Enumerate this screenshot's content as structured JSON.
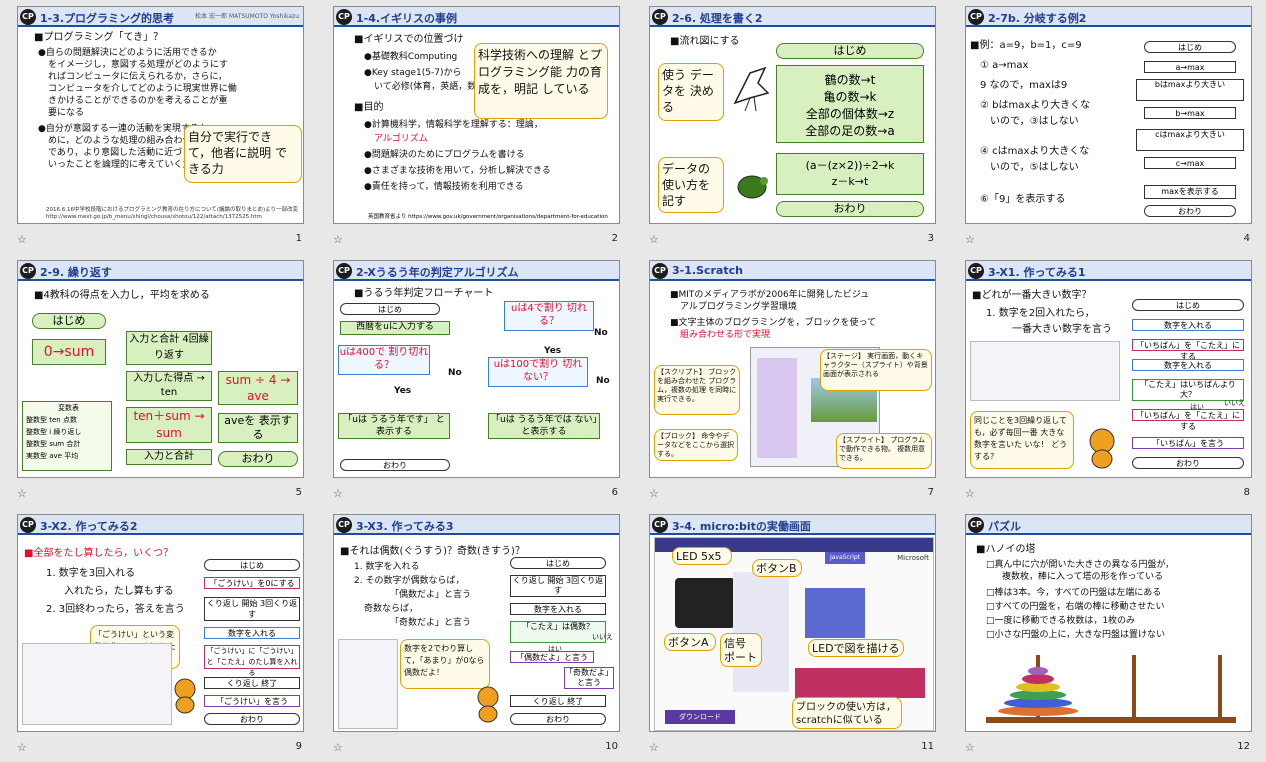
{
  "slides": [
    {
      "num": "1",
      "title": "1-3.プログラミング的思考",
      "lines": [
        "■プログラミング「てき」？",
        "●自らの問題解決にどのように活用できるか",
        "をイメージし，意図する処理がどのようにす",
        "ればコンピュータに伝えられるか，さらに，",
        "コンピュータを介してどのように現実世界に働",
        "きかけることができるのかを考えることが重",
        "要になる",
        "●自分が意図する一連の活動を実現するた",
        "めに，どのような処理の組み合わせが必要",
        "であり，より意図した活動に近づくのか，と",
        "いったことを論理的に考えていく力"
      ],
      "callout": "自分で実行でき て，他者に説明 できる力",
      "footer": "2016.6.16中学校段階におけるプログラミング教育の在り方について(議論の取りまとめ)より一部改変 http://www.mext.go.jp/b_menu/shingi/chousa/shotou/122/attach/1372525.htm"
    },
    {
      "num": "2",
      "title": "1-4.イギリスの事例",
      "lines": [
        "■イギリスでの位置づけ",
        "●基礎教科Computing",
        "●Key stage1(5-7)から",
        "いて必修(体育，英語，数学と同列)",
        "■目的",
        "●計算機科学，情報科学を理解する：理論，",
        "アルゴリズム",
        "●問題解決のためにプログラムを書ける",
        "●さまざまな技術を用いて，分析し解決できる",
        "●責任を持って，情報技術を利用できる"
      ],
      "callout": "科学技術への理解 とプログラミング能 力の育成を，明記 している",
      "footer": "英国教育省より https://www.gov.uk/government/organisations/department-for-education"
    },
    {
      "num": "3",
      "title": "2-6. 処理を書く2",
      "lines": [
        "■流れ図にする"
      ],
      "start": "はじめ",
      "p1": [
        "鶴の数→t",
        "亀の数→k",
        "全部の個体数→z",
        "全部の足の数→a"
      ],
      "p2": [
        "(a－(z×2))÷2→k",
        "z－k→t"
      ],
      "end": "おわり",
      "c1": "使う データを 決める",
      "c2": "データの 使い方を 記す"
    },
    {
      "num": "4",
      "title": "2-7b. 分岐する例2",
      "lines": [
        "■例：a=9，b=1，c=9",
        "① a→max",
        "9 なので，maxは9",
        "② bはmaxより大きくな",
        "いので，③はしない",
        "④ cはmaxより大きくな",
        "いので，⑤はしない",
        "⑥「9」を表示する"
      ],
      "flow": [
        "はじめ",
        "a→max",
        "bはmaxより大きい",
        "b→max",
        "cはmaxより大きい",
        "c→max",
        "maxを表示する",
        "おわり"
      ]
    },
    {
      "num": "5",
      "title": "2-9. 繰り返す",
      "lines": [
        "■4教科の得点を入力し，平均を求める"
      ],
      "flow": [
        "はじめ",
        "0→sum",
        "入力と合計 4回繰り返す",
        "入力した得点 → ten",
        "ten＋sum → sum",
        "入力と合計",
        "sum ÷ 4 → ave",
        "aveを 表示する",
        "おわり"
      ],
      "vars": [
        "変数表",
        "整数型 ten 点数",
        "整数型 i 繰り返し",
        "整数型 sum 合計",
        "実数型 ave 平均"
      ]
    },
    {
      "num": "6",
      "title": "2-Xうるう年の判定アルゴリズム",
      "lines": [
        "■うるう年判定フローチャート"
      ],
      "flow": [
        "はじめ",
        "西暦をuに入力する",
        "uは4で割り 切れる？",
        "uは400で 割り切れる？",
        "uは100で割り 切れない？",
        "「uは うるう年です」 と表示する",
        "「uは うるう年では ない」と表示する",
        "おわり",
        "No",
        "Yes",
        "No",
        "Yes",
        "No"
      ]
    },
    {
      "num": "7",
      "title": "3-1.Scratch",
      "lines": [
        "■MITのメディアラボが2006年に開発したビジュ",
        "アルプログラミング学習環境",
        "■文字主体のプログラミングを，ブロックを使って",
        "組み合わせる形で実現"
      ],
      "notes": [
        "【スクリプト】 ブロックを組み合わせた プログラム，複数の処理 を同時に実行できる。",
        "【ステージ】 実行画面，動くキャラクター（スプライト）や背景画面が表示される",
        "【ブロック】 命令やデータなどをここから選択する。",
        "【スプライト】 プログラムで動作できる物。 複数用意できる。"
      ]
    },
    {
      "num": "8",
      "title": "3-X1. 作ってみる1",
      "lines": [
        "■どれが一番大きい数字？",
        "1. 数字を2回入れたら，",
        "一番大きい数字を言う"
      ],
      "flow": [
        "はじめ",
        "数字を入れる",
        "「いちばん」を「こたえ」にする",
        "数字を入れる",
        "「こたえ」はいちばんより大？",
        "「いちばん」を「こたえ」にする",
        "「いちばん」を言う",
        "おわり",
        "いいえ",
        "はい"
      ],
      "callout": "同じことを3回繰り返して も，必ず毎回一番 大きな数字を言いた いな！ どうする？"
    },
    {
      "num": "9",
      "title": "3-X2. 作ってみる2",
      "lines": [
        "■全部をたし算したら，いくつ？",
        "1. 数字を3回入れる",
        "入れたら，たし算もする",
        "2. 3回終わったら，答えを言う"
      ],
      "flow": [
        "はじめ",
        "「ごうけい」を0にする",
        "くり返し 開始 3回くり返す",
        "数字を入れる",
        "「ごうけい」に「ごうけい」と「こたえ」のたし算を入れる",
        "くり返し 終了",
        "「ごうけい」を言う",
        "おわり"
      ],
      "callout": "「ごうけい」という変 数を作って，それ にたし算していく"
    },
    {
      "num": "10",
      "title": "3-X3. 作ってみる3",
      "lines": [
        "■それは偶数(ぐうすう)？奇数(きすう)？",
        "1. 数字を入れる",
        "2. その数字が偶数ならば，",
        "「偶数だよ」と言う",
        "奇数ならば，",
        "「奇数だよ」と言う"
      ],
      "flow": [
        "はじめ",
        "くり返し 開始 3回くり返す",
        "数字を入れる",
        "「こたえ」は偶数？",
        "「偶数だよ」と言う",
        "「奇数だよ」と言う",
        "くり返し 終了",
        "おわり",
        "はい",
        "いいえ"
      ],
      "callout": "数字を2でわり算して，「あまり」が0なら偶数だよ！"
    },
    {
      "num": "11",
      "title": "3-4. micro:bitの実働画面",
      "labels": [
        "LED 5x5",
        "ボタンB",
        "ボタンA",
        "信号 ポート",
        "LEDで図を描ける",
        "ブロックの使い方は， scratchに似ている"
      ],
      "download": "ダウンロード",
      "ms": "Microsoft",
      "js": "JavaScript"
    },
    {
      "num": "12",
      "title": "パズル",
      "lines": [
        "■ハノイの塔",
        "□真ん中に穴が開いた大きさの異なる円盤が，",
        "複数枚，棒に入って塔の形を作っている",
        "□棒は3本。今，すべての円盤は左端にある",
        "□すべての円盤を，右端の棒に移動させたい",
        "□一度に移動できる枚数は，1枚のみ",
        "□小さな円盤の上に，大きな円盤は置けない"
      ]
    }
  ],
  "author": "松本 宏一郎 MATSUMOTO Yoshikazu",
  "logo": "CP",
  "star": "☆"
}
